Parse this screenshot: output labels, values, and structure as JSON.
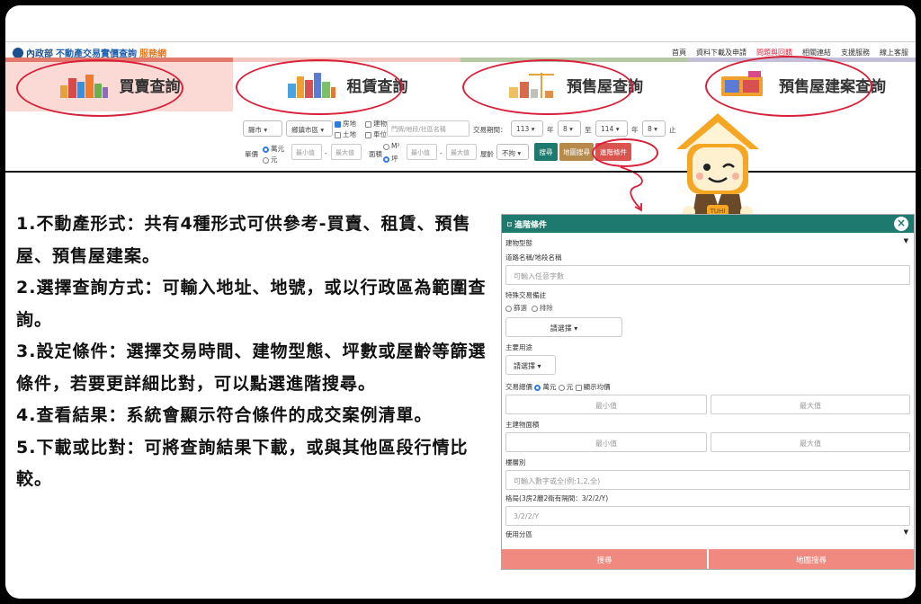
{
  "site": {
    "ministry": "內政部",
    "name_main": "不動產交易實價查詢",
    "name_accent": "服務網",
    "links": [
      "首頁",
      "資料下載及申請",
      "問題與回饋",
      "相關連結",
      "支援服務",
      "線上客服"
    ]
  },
  "tabs": [
    {
      "label": "買賣查詢"
    },
    {
      "label": "租賃查詢"
    },
    {
      "label": "預售屋查詢"
    },
    {
      "label": "預售屋建案查詢"
    }
  ],
  "filters": {
    "city": "縣市",
    "district": "鄉鎮市區",
    "type_land_house": "房地",
    "type_building": "建物",
    "type_land": "土地",
    "type_parking": "車位",
    "address_placeholder": "門牌/地段/社區名稱",
    "period_label": "交易期間：",
    "year_from": "113",
    "month_from": "8",
    "to_label": "至",
    "year_to": "114",
    "month_to": "8",
    "year_unit": "年",
    "stop_label": "止",
    "unit_price_label": "單價",
    "unit_wan": "萬元",
    "unit_yuan": "元",
    "min_placeholder": "最小值",
    "max_placeholder": "最大值",
    "area_label": "面積",
    "area_m2": "M²",
    "area_ping": "坪",
    "age_label": "屋齡",
    "age_value": "不拘",
    "search_btn": "搜尋",
    "map_search_btn": "地圖搜尋",
    "advanced_btn": "進階條件"
  },
  "steps": [
    "1.不動產形式：共有4種形式可供參考-買賣、租賃、預售屋、預售屋建案。",
    "2.選擇查詢方式：可輸入地址、地號，或以行政區為範圍查詢。",
    "3.設定條件：選擇交易時間、建物型態、坪數或屋齡等篩選條件，若要更詳細比對，可以點選進階搜尋。",
    "4.查看結果：系統會顯示符合條件的成交案例清單。",
    "5.下載或比對：可將查詢結果下載，或與其他區段行情比較。"
  ],
  "panel": {
    "title": "進階條件",
    "building_type": "建物型態",
    "road_label": "道路名稱/地段名稱",
    "road_placeholder": "可輸入任意字數",
    "special_label": "特殊交易備註",
    "special_opt1": "篩選",
    "special_opt2": "排除",
    "choose": "請選擇",
    "usage_label": "主要用途",
    "total_label": "交易總價",
    "total_wan": "萬元",
    "total_yuan": "元",
    "show_avg": "顯示均價",
    "min": "最小值",
    "max": "最大值",
    "main_area_label": "主建物面積",
    "floor_label": "樓層別",
    "floor_placeholder": "可輸入數字或全(例:1,2,全)",
    "layout_label": "格局(3房2廳2衛有隔間：3/2/2/Y)",
    "layout_placeholder": "3/2/2/Y",
    "zone_label": "使用分區",
    "search": "搜尋",
    "map_search": "地圖搜尋"
  },
  "mascot": {
    "badge": "TUHI"
  }
}
